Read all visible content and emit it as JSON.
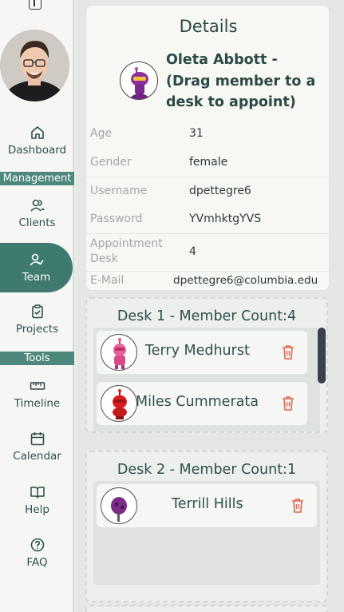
{
  "sidebar": {
    "items": [
      {
        "label": "Dashboard",
        "icon": "home-icon"
      },
      {
        "label": "Clients",
        "icon": "users-icon"
      },
      {
        "label": "Team",
        "icon": "user-check-icon",
        "active": true
      },
      {
        "label": "Projects",
        "icon": "clipboard-icon"
      },
      {
        "label": "Timeline",
        "icon": "ruler-icon"
      },
      {
        "label": "Calendar",
        "icon": "calendar-icon"
      },
      {
        "label": "Help",
        "icon": "book-open-icon"
      },
      {
        "label": "FAQ",
        "icon": "help-circle-icon"
      }
    ],
    "sections": {
      "management": "Management",
      "tools": "Tools"
    },
    "accent": "#3f7a70"
  },
  "details": {
    "title": "Details",
    "name": "Oleta Abbott - (Drag member to a desk to appoint)",
    "fields": [
      {
        "label": "Age",
        "value": "31"
      },
      {
        "label": "Gender",
        "value": "female"
      },
      {
        "label": "Username",
        "value": "dpettegre6"
      },
      {
        "label": "Password",
        "value": "YVmhktgYVS"
      },
      {
        "label": "Appointment Desk",
        "value": "4"
      },
      {
        "label": "E-Mail",
        "value": "dpettegre6@columbia.edu"
      }
    ]
  },
  "desks": [
    {
      "title": "Desk 1 - Member Count:4",
      "members": [
        "Terry Medhurst",
        "Miles Cummerata"
      ]
    },
    {
      "title": "Desk 2 - Member Count:1",
      "members": [
        "Terrill Hills"
      ]
    }
  ],
  "colors": {
    "trash": "#e0644f",
    "accent": "#3f7a70"
  }
}
